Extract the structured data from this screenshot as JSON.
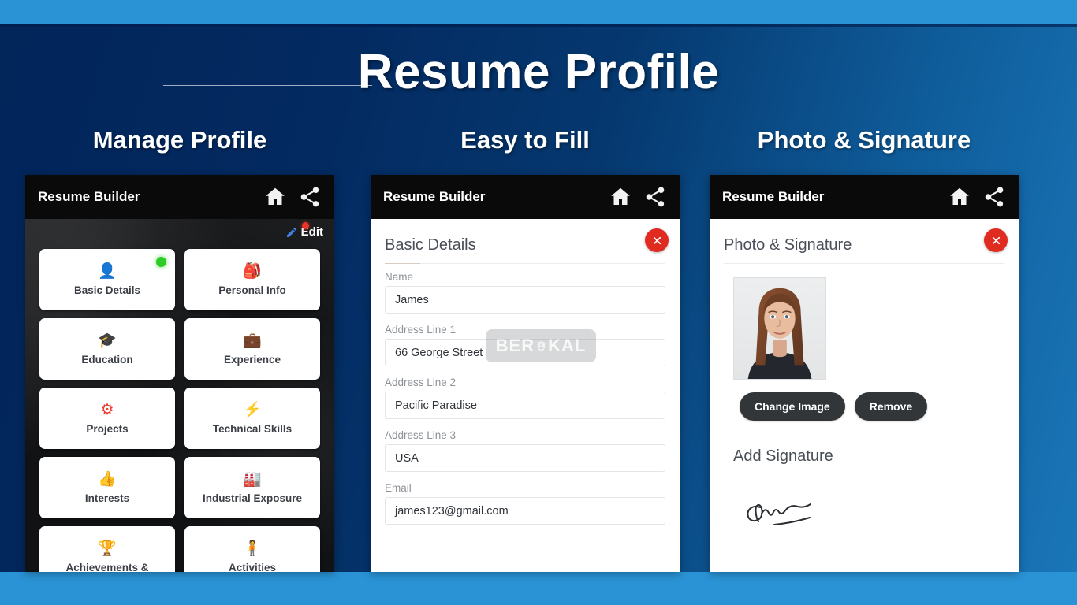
{
  "hero": {
    "title": "Resume Profile"
  },
  "sections": [
    {
      "heading": "Manage Profile"
    },
    {
      "heading": "Easy to Fill"
    },
    {
      "heading": "Photo & Signature"
    }
  ],
  "panel1": {
    "appbar": {
      "title": "Resume Builder",
      "home_icon": "home-icon",
      "share_icon": "share-icon"
    },
    "edit": {
      "label": "Edit",
      "icon": "pencil-icon",
      "badge": "notification-dot"
    },
    "tiles": [
      {
        "label": "Basic Details",
        "icon": "👤",
        "badge": "status-dot-green"
      },
      {
        "label": "Personal Info",
        "icon": "🎒",
        "badge": ""
      },
      {
        "label": "Education",
        "icon": "🎓",
        "badge": ""
      },
      {
        "label": "Experience",
        "icon": "💼",
        "badge": ""
      },
      {
        "label": "Projects",
        "icon": "⚙",
        "badge": ""
      },
      {
        "label": "Technical Skills",
        "icon": "⚡",
        "badge": ""
      },
      {
        "label": "Interests",
        "icon": "👍",
        "badge": ""
      },
      {
        "label": "Industrial Exposure",
        "icon": "🏭",
        "badge": ""
      },
      {
        "label": "Achievements &",
        "icon": "🏆",
        "badge": ""
      },
      {
        "label": "Activities",
        "icon": "🧍",
        "badge": ""
      }
    ]
  },
  "panel2": {
    "appbar": {
      "title": "Resume Builder",
      "home_icon": "home-icon",
      "share_icon": "share-icon"
    },
    "section_title": "Basic Details",
    "close_icon": "close-icon",
    "fields": [
      {
        "label": "Name",
        "value": "James"
      },
      {
        "label": "Address Line 1",
        "value": "66 George Street"
      },
      {
        "label": "Address Line 2",
        "value": "Pacific Paradise"
      },
      {
        "label": "Address Line 3",
        "value": "USA"
      },
      {
        "label": "Email",
        "value": "james123@gmail.com"
      }
    ],
    "watermark": {
      "text_left": "BER",
      "text_right": "KAL",
      "logo_icon": "berakal-logo-icon"
    }
  },
  "panel3": {
    "appbar": {
      "title": "Resume Builder",
      "home_icon": "home-icon",
      "share_icon": "share-icon"
    },
    "section_title": "Photo & Signature",
    "close_icon": "close-icon",
    "photo_alt": "profile-photo",
    "buttons": [
      {
        "label": "Change Image"
      },
      {
        "label": "Remove"
      }
    ],
    "add_signature_title": "Add Signature",
    "signature_alt": "handwritten-signature"
  },
  "colors": {
    "band": "#2a93d5",
    "backdrop_dark": "#032a61",
    "backdrop_light": "#1a76b8",
    "appbar": "#0a0a0a",
    "close_red": "#e02b20",
    "status_green": "#2ecc27",
    "pill_dark": "#323639"
  }
}
